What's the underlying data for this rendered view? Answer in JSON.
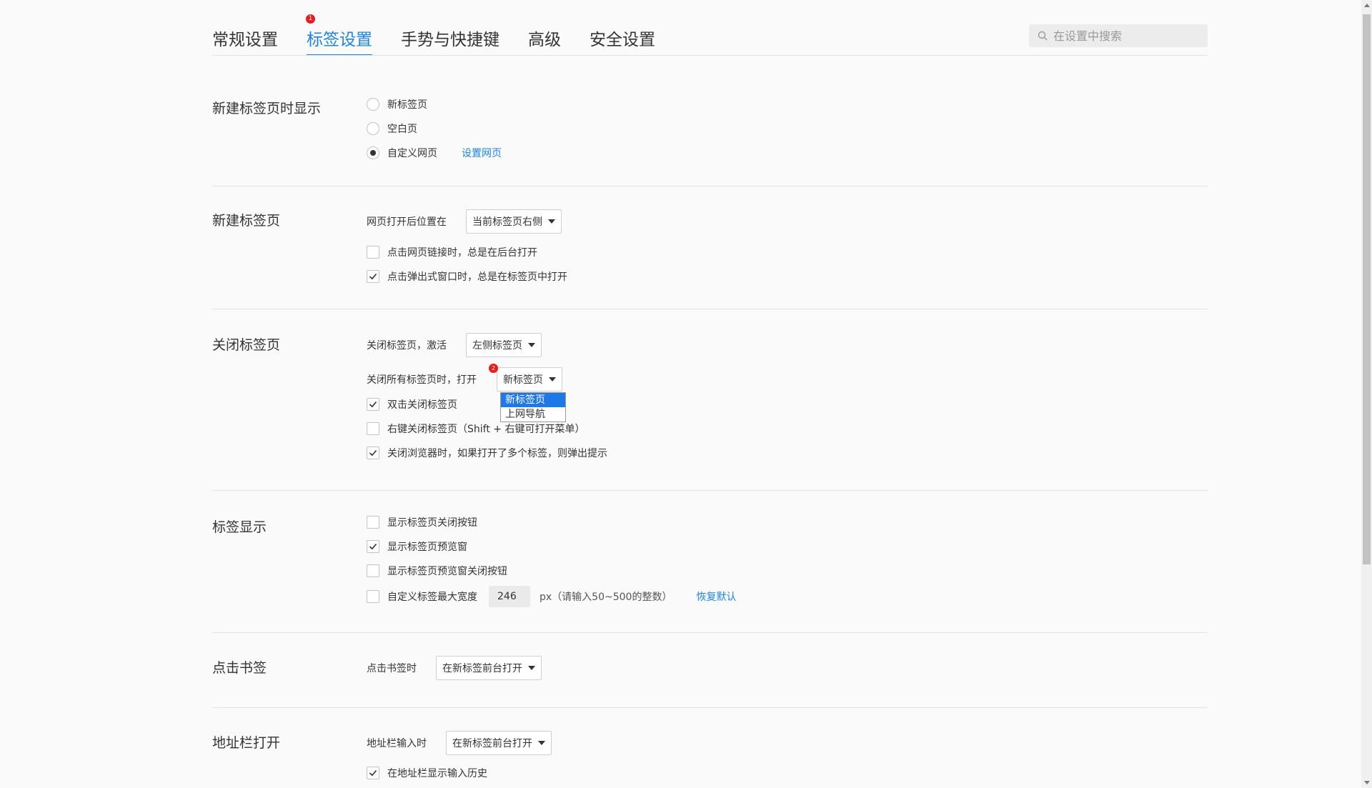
{
  "nav": {
    "tabs": [
      {
        "label": "常规设置"
      },
      {
        "label": "标签设置",
        "badge": "1"
      },
      {
        "label": "手势与快捷键"
      },
      {
        "label": "高级"
      },
      {
        "label": "安全设置"
      }
    ],
    "search_placeholder": "在设置中搜索"
  },
  "new_tab_display": {
    "title": "新建标签页时显示",
    "options": [
      "新标签页",
      "空白页",
      "自定义网页"
    ],
    "selected": "自定义网页",
    "set_link": "设置网页"
  },
  "new_tab": {
    "title": "新建标签页",
    "position_label": "网页打开后位置在",
    "position_value": "当前标签页右侧",
    "opt1": "点击网页链接时，总是在后台打开",
    "opt1_checked": false,
    "opt2": "点击弹出式窗口时，总是在标签页中打开",
    "opt2_checked": true
  },
  "close_tab": {
    "title": "关闭标签页",
    "activate_label": "关闭标签页，激活",
    "activate_value": "左侧标签页",
    "close_all_label": "关闭所有标签页时，打开",
    "close_all_value": "新标签页",
    "close_all_badge": "2",
    "dropdown_options": [
      "新标签页",
      "上网导航"
    ],
    "dropdown_selected": "新标签页",
    "opt1": "双击关闭标签页",
    "opt1_checked": true,
    "opt2": "右键关闭标签页（Shift + 右键可打开菜单）",
    "opt2_checked": false,
    "opt3": "关闭浏览器时，如果打开了多个标签，则弹出提示",
    "opt3_checked": true
  },
  "tab_display": {
    "title": "标签显示",
    "opt1": "显示标签页关闭按钮",
    "opt1_checked": false,
    "opt2": "显示标签页预览窗",
    "opt2_checked": true,
    "opt3": "显示标签页预览窗关闭按钮",
    "opt3_checked": false,
    "opt4": "自定义标签最大宽度",
    "opt4_checked": false,
    "width_value": "246",
    "width_hint": "px（请输入50~500的整数）",
    "restore_link": "恢复默认"
  },
  "bookmark": {
    "title": "点击书签",
    "label": "点击书签时",
    "value": "在新标签前台打开"
  },
  "address_bar": {
    "title": "地址栏打开",
    "label": "地址栏输入时",
    "value": "在新标签前台打开",
    "opt1": "在地址栏显示输入历史",
    "opt1_checked": true
  },
  "colors": {
    "accent": "#1a84e6",
    "badge": "#e81c1c",
    "selected_item": "#1e78e6"
  }
}
